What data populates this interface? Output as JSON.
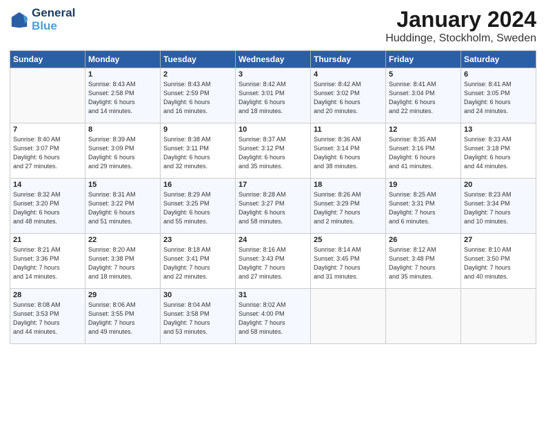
{
  "logo": {
    "line1": "General",
    "line2": "Blue"
  },
  "title": "January 2024",
  "location": "Huddinge, Stockholm, Sweden",
  "days_of_week": [
    "Sunday",
    "Monday",
    "Tuesday",
    "Wednesday",
    "Thursday",
    "Friday",
    "Saturday"
  ],
  "weeks": [
    [
      {
        "num": "",
        "sunrise": "",
        "sunset": "",
        "daylight": ""
      },
      {
        "num": "1",
        "sunrise": "Sunrise: 8:43 AM",
        "sunset": "Sunset: 2:58 PM",
        "daylight": "Daylight: 6 hours and 14 minutes."
      },
      {
        "num": "2",
        "sunrise": "Sunrise: 8:43 AM",
        "sunset": "Sunset: 2:59 PM",
        "daylight": "Daylight: 6 hours and 16 minutes."
      },
      {
        "num": "3",
        "sunrise": "Sunrise: 8:42 AM",
        "sunset": "Sunset: 3:01 PM",
        "daylight": "Daylight: 6 hours and 18 minutes."
      },
      {
        "num": "4",
        "sunrise": "Sunrise: 8:42 AM",
        "sunset": "Sunset: 3:02 PM",
        "daylight": "Daylight: 6 hours and 20 minutes."
      },
      {
        "num": "5",
        "sunrise": "Sunrise: 8:41 AM",
        "sunset": "Sunset: 3:04 PM",
        "daylight": "Daylight: 6 hours and 22 minutes."
      },
      {
        "num": "6",
        "sunrise": "Sunrise: 8:41 AM",
        "sunset": "Sunset: 3:05 PM",
        "daylight": "Daylight: 6 hours and 24 minutes."
      }
    ],
    [
      {
        "num": "7",
        "sunrise": "Sunrise: 8:40 AM",
        "sunset": "Sunset: 3:07 PM",
        "daylight": "Daylight: 6 hours and 27 minutes."
      },
      {
        "num": "8",
        "sunrise": "Sunrise: 8:39 AM",
        "sunset": "Sunset: 3:09 PM",
        "daylight": "Daylight: 6 hours and 29 minutes."
      },
      {
        "num": "9",
        "sunrise": "Sunrise: 8:38 AM",
        "sunset": "Sunset: 3:11 PM",
        "daylight": "Daylight: 6 hours and 32 minutes."
      },
      {
        "num": "10",
        "sunrise": "Sunrise: 8:37 AM",
        "sunset": "Sunset: 3:12 PM",
        "daylight": "Daylight: 6 hours and 35 minutes."
      },
      {
        "num": "11",
        "sunrise": "Sunrise: 8:36 AM",
        "sunset": "Sunset: 3:14 PM",
        "daylight": "Daylight: 6 hours and 38 minutes."
      },
      {
        "num": "12",
        "sunrise": "Sunrise: 8:35 AM",
        "sunset": "Sunset: 3:16 PM",
        "daylight": "Daylight: 6 hours and 41 minutes."
      },
      {
        "num": "13",
        "sunrise": "Sunrise: 8:33 AM",
        "sunset": "Sunset: 3:18 PM",
        "daylight": "Daylight: 6 hours and 44 minutes."
      }
    ],
    [
      {
        "num": "14",
        "sunrise": "Sunrise: 8:32 AM",
        "sunset": "Sunset: 3:20 PM",
        "daylight": "Daylight: 6 hours and 48 minutes."
      },
      {
        "num": "15",
        "sunrise": "Sunrise: 8:31 AM",
        "sunset": "Sunset: 3:22 PM",
        "daylight": "Daylight: 6 hours and 51 minutes."
      },
      {
        "num": "16",
        "sunrise": "Sunrise: 8:29 AM",
        "sunset": "Sunset: 3:25 PM",
        "daylight": "Daylight: 6 hours and 55 minutes."
      },
      {
        "num": "17",
        "sunrise": "Sunrise: 8:28 AM",
        "sunset": "Sunset: 3:27 PM",
        "daylight": "Daylight: 6 hours and 58 minutes."
      },
      {
        "num": "18",
        "sunrise": "Sunrise: 8:26 AM",
        "sunset": "Sunset: 3:29 PM",
        "daylight": "Daylight: 7 hours and 2 minutes."
      },
      {
        "num": "19",
        "sunrise": "Sunrise: 8:25 AM",
        "sunset": "Sunset: 3:31 PM",
        "daylight": "Daylight: 7 hours and 6 minutes."
      },
      {
        "num": "20",
        "sunrise": "Sunrise: 8:23 AM",
        "sunset": "Sunset: 3:34 PM",
        "daylight": "Daylight: 7 hours and 10 minutes."
      }
    ],
    [
      {
        "num": "21",
        "sunrise": "Sunrise: 8:21 AM",
        "sunset": "Sunset: 3:36 PM",
        "daylight": "Daylight: 7 hours and 14 minutes."
      },
      {
        "num": "22",
        "sunrise": "Sunrise: 8:20 AM",
        "sunset": "Sunset: 3:38 PM",
        "daylight": "Daylight: 7 hours and 18 minutes."
      },
      {
        "num": "23",
        "sunrise": "Sunrise: 8:18 AM",
        "sunset": "Sunset: 3:41 PM",
        "daylight": "Daylight: 7 hours and 22 minutes."
      },
      {
        "num": "24",
        "sunrise": "Sunrise: 8:16 AM",
        "sunset": "Sunset: 3:43 PM",
        "daylight": "Daylight: 7 hours and 27 minutes."
      },
      {
        "num": "25",
        "sunrise": "Sunrise: 8:14 AM",
        "sunset": "Sunset: 3:45 PM",
        "daylight": "Daylight: 7 hours and 31 minutes."
      },
      {
        "num": "26",
        "sunrise": "Sunrise: 8:12 AM",
        "sunset": "Sunset: 3:48 PM",
        "daylight": "Daylight: 7 hours and 35 minutes."
      },
      {
        "num": "27",
        "sunrise": "Sunrise: 8:10 AM",
        "sunset": "Sunset: 3:50 PM",
        "daylight": "Daylight: 7 hours and 40 minutes."
      }
    ],
    [
      {
        "num": "28",
        "sunrise": "Sunrise: 8:08 AM",
        "sunset": "Sunset: 3:53 PM",
        "daylight": "Daylight: 7 hours and 44 minutes."
      },
      {
        "num": "29",
        "sunrise": "Sunrise: 8:06 AM",
        "sunset": "Sunset: 3:55 PM",
        "daylight": "Daylight: 7 hours and 49 minutes."
      },
      {
        "num": "30",
        "sunrise": "Sunrise: 8:04 AM",
        "sunset": "Sunset: 3:58 PM",
        "daylight": "Daylight: 7 hours and 53 minutes."
      },
      {
        "num": "31",
        "sunrise": "Sunrise: 8:02 AM",
        "sunset": "Sunset: 4:00 PM",
        "daylight": "Daylight: 7 hours and 58 minutes."
      },
      {
        "num": "",
        "sunrise": "",
        "sunset": "",
        "daylight": ""
      },
      {
        "num": "",
        "sunrise": "",
        "sunset": "",
        "daylight": ""
      },
      {
        "num": "",
        "sunrise": "",
        "sunset": "",
        "daylight": ""
      }
    ]
  ]
}
